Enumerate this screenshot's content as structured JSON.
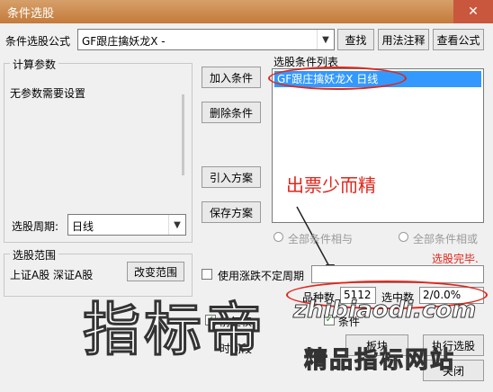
{
  "window": {
    "title": "条件选股",
    "close_label": "✕"
  },
  "formula": {
    "label": "条件选股公式",
    "value": "GF跟庄擒妖龙X  -",
    "find_btn": "查找",
    "usage_btn": "用法注释",
    "view_btn": "查看公式"
  },
  "params": {
    "group_title": "计算参数",
    "text": "无参数需要设置"
  },
  "actions": {
    "add": "加入条件",
    "delete": "删除条件",
    "import": "引入方案",
    "save": "保存方案"
  },
  "conditions": {
    "title": "选股条件列表",
    "items": [
      "GF跟庄擒妖龙X  日线"
    ]
  },
  "annotation": {
    "text": "出票少而精",
    "color": "#e1261c"
  },
  "period": {
    "label": "选股周期:",
    "value": "日线"
  },
  "logic": {
    "and_label": "全部条件相与",
    "or_label": "全部条件相或"
  },
  "done_text": "选股完毕.",
  "range": {
    "title": "选股范围",
    "markets": "上证A股 深证A股",
    "change_btn": "改变范围"
  },
  "variable_period": {
    "label": "使用涨跌不定周期"
  },
  "stats": {
    "count_label": "品种数",
    "count_value": "5112",
    "selected_label": "选中数",
    "selected_value": "2/0.0%"
  },
  "options": {
    "fq_label": "前复权",
    "cond_label": "条件",
    "time_label": "时间段",
    "board_label": "板块"
  },
  "bottom_buttons": {
    "run": "执行选股",
    "close": "关闭"
  },
  "watermarks": {
    "big": "指标帝",
    "url": "zhibiaodi.com",
    "sub": "精品指标网站"
  }
}
